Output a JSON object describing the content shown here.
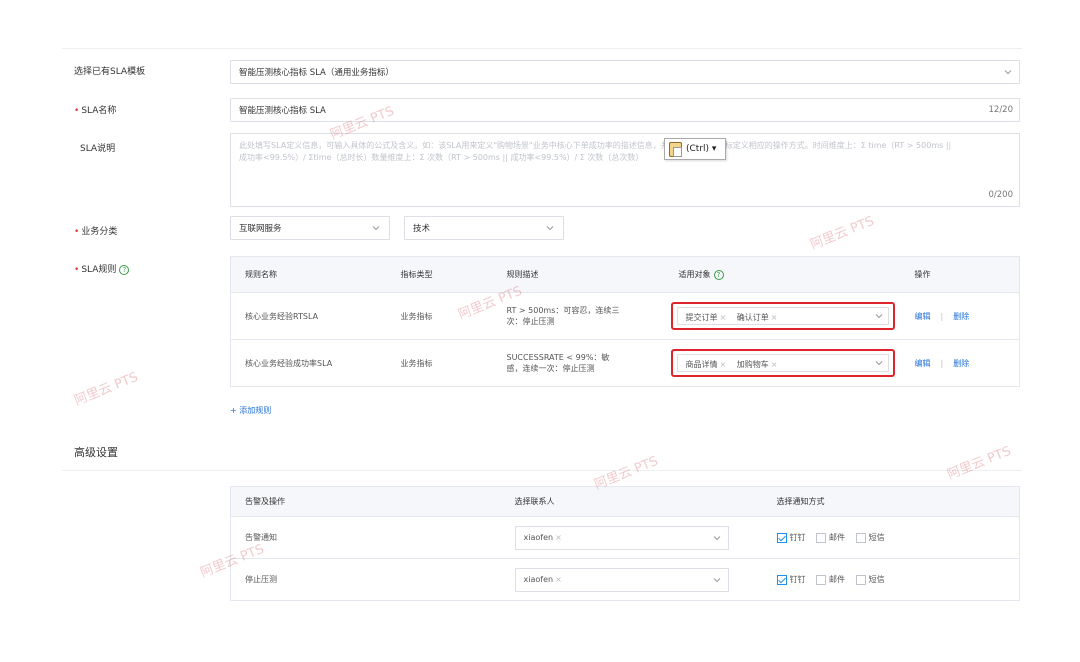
{
  "form": {
    "template_label": "选择已有SLA模板",
    "template_value": "智能压测核心指标 SLA（通用业务指标）",
    "name_label": "SLA名称",
    "name_value": "智能压测核心指标 SLA",
    "name_counter": "12/20",
    "desc_label": "SLA说明",
    "desc_placeholder": "此处填写SLA定义信息，可输入具体的公式及含义。如：该SLA用来定义\"购物场景\"业务中核心下单成功率的描述信息，并针对不同量级指标定义相应的操作方式。时间维度上：Σ time（RT > 500ms || 成功率<99.5%）/ Σtime（总时长）数量维度上：Σ 次数（RT > 500ms || 成功率<99.5%）/ Σ 次数（总次数）",
    "desc_counter": "0/200",
    "category_label": "业务分类",
    "category_primary": "互联网服务",
    "category_secondary": "技术",
    "rules_label": "SLA规则",
    "add_rule": "+ 添加规则"
  },
  "paste_popup": {
    "label": "(Ctrl)",
    "arrow": "▾"
  },
  "rules_table": {
    "headers": [
      "规则名称",
      "指标类型",
      "规则描述",
      "适用对象",
      "操作"
    ],
    "rows": [
      {
        "name": "核心业务经验RTSLA",
        "type": "业务指标",
        "desc_line1": "RT > 500ms：可容忍，连续三",
        "desc_line2": "次：停止压测",
        "targets": [
          "提交订单",
          "确认订单"
        ],
        "edit": "编辑",
        "delete": "删除"
      },
      {
        "name": "核心业务经验成功率SLA",
        "type": "业务指标",
        "desc_line1": "SUCCESSRATE < 99%：敏",
        "desc_line2": "感，连续一次：停止压测",
        "targets": [
          "商品详情",
          "加购物车"
        ],
        "edit": "编辑",
        "delete": "删除"
      }
    ]
  },
  "advanced": {
    "title": "高级设置",
    "headers": [
      "告警及操作",
      "选择联系人",
      "选择通知方式"
    ],
    "rows": [
      {
        "action": "告警通知",
        "contact": "xiaofen",
        "notify": [
          {
            "label": "钉钉",
            "checked": true
          },
          {
            "label": "邮件",
            "checked": false
          },
          {
            "label": "短信",
            "checked": false
          }
        ]
      },
      {
        "action": "停止压测",
        "contact": "xiaofen",
        "notify": [
          {
            "label": "钉钉",
            "checked": true
          },
          {
            "label": "邮件",
            "checked": false
          },
          {
            "label": "短信",
            "checked": false
          }
        ]
      }
    ]
  },
  "watermark": "阿里云 PTS",
  "colors": {
    "required": "#e23c39",
    "link": "#1f6fd8",
    "highlight": "#e0242b",
    "checkbox": "#1f8ff0"
  },
  "icons": {
    "dropdown": "chevron-down-icon",
    "help": "help-circle-icon",
    "remove": "close-icon",
    "paste": "clipboard-icon"
  }
}
